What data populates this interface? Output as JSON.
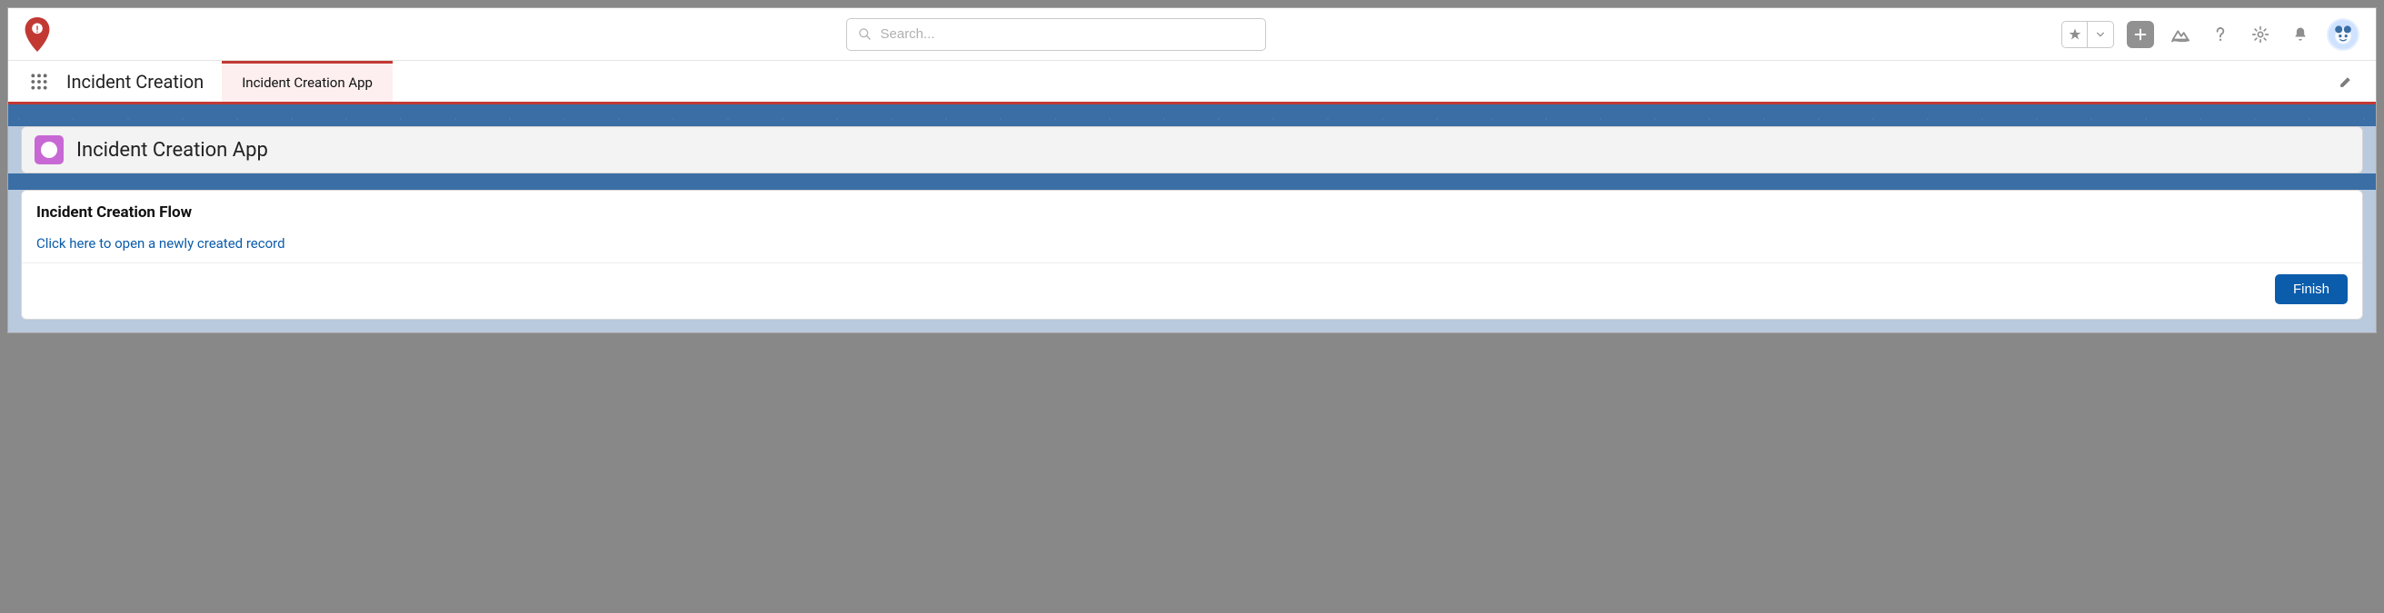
{
  "header": {
    "search_placeholder": "Search..."
  },
  "nav": {
    "app_name": "Incident Creation",
    "tabs": [
      {
        "label": "Incident Creation App",
        "active": true
      }
    ]
  },
  "page_header": {
    "title": "Incident Creation App"
  },
  "card": {
    "title": "Incident Creation Flow",
    "link_text": "Click here to open a newly created record",
    "finish_label": "Finish"
  }
}
